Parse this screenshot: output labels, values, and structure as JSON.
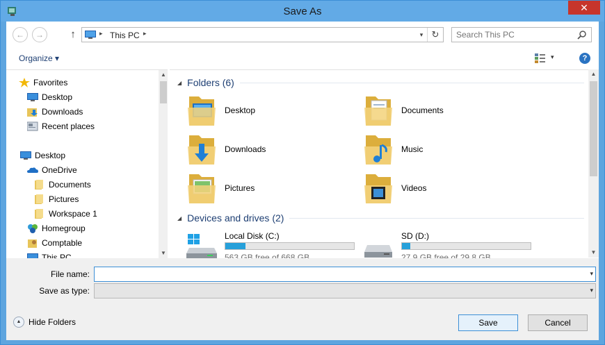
{
  "window": {
    "title": "Save As",
    "close_glyph": "✕"
  },
  "nav": {
    "back_glyph": "←",
    "forward_glyph": "→",
    "up_glyph": "↑"
  },
  "address": {
    "path": "This PC",
    "dropdown_glyph": "▾",
    "refresh_glyph": "↻"
  },
  "search": {
    "placeholder": "Search This PC"
  },
  "toolbar": {
    "organize_label": "Organize ▾",
    "view_dropdown_glyph": "▾",
    "help_glyph": "?"
  },
  "sidebar": {
    "items": [
      {
        "label": "Favorites",
        "icon": "star-icon"
      },
      {
        "label": "Desktop",
        "icon": "desktop-icon"
      },
      {
        "label": "Downloads",
        "icon": "downloads-folder-icon"
      },
      {
        "label": "Recent places",
        "icon": "recent-places-icon"
      },
      {
        "label": "Desktop",
        "icon": "desktop-icon"
      },
      {
        "label": "OneDrive",
        "icon": "onedrive-cloud-icon"
      },
      {
        "label": "Documents",
        "icon": "folder-icon"
      },
      {
        "label": "Pictures",
        "icon": "folder-icon"
      },
      {
        "label": "Workspace 1",
        "icon": "folder-icon"
      },
      {
        "label": "Homegroup",
        "icon": "homegroup-icon"
      },
      {
        "label": "Comptable",
        "icon": "user-folder-icon"
      },
      {
        "label": "This PC",
        "icon": "this-pc-icon"
      }
    ]
  },
  "content": {
    "folders_header": "Folders (6)",
    "folders": [
      {
        "label": "Desktop",
        "icon": "desktop-folder-icon"
      },
      {
        "label": "Documents",
        "icon": "documents-folder-icon"
      },
      {
        "label": "Downloads",
        "icon": "downloads-folder-icon"
      },
      {
        "label": "Music",
        "icon": "music-folder-icon"
      },
      {
        "label": "Pictures",
        "icon": "pictures-folder-icon"
      },
      {
        "label": "Videos",
        "icon": "videos-folder-icon"
      }
    ],
    "drives_header": "Devices and drives (2)",
    "drives": [
      {
        "label": "Local Disk (C:)",
        "free": "563 GB free of 668 GB",
        "used_fraction": 0.157,
        "icon": "windows-drive-icon"
      },
      {
        "label": "SD (D:)",
        "free": "27.9 GB free of 29.8 GB",
        "used_fraction": 0.064,
        "icon": "removable-drive-icon"
      }
    ]
  },
  "form": {
    "file_name_label": "File name:",
    "file_name_value": "",
    "save_as_type_label": "Save as type:",
    "save_as_type_value": ""
  },
  "footer": {
    "hide_folders_label": "Hide Folders",
    "save_label": "Save",
    "cancel_label": "Cancel"
  },
  "colors": {
    "accent": "#3c8fd6",
    "progress": "#26a0da",
    "link_text": "#1e3f73"
  }
}
